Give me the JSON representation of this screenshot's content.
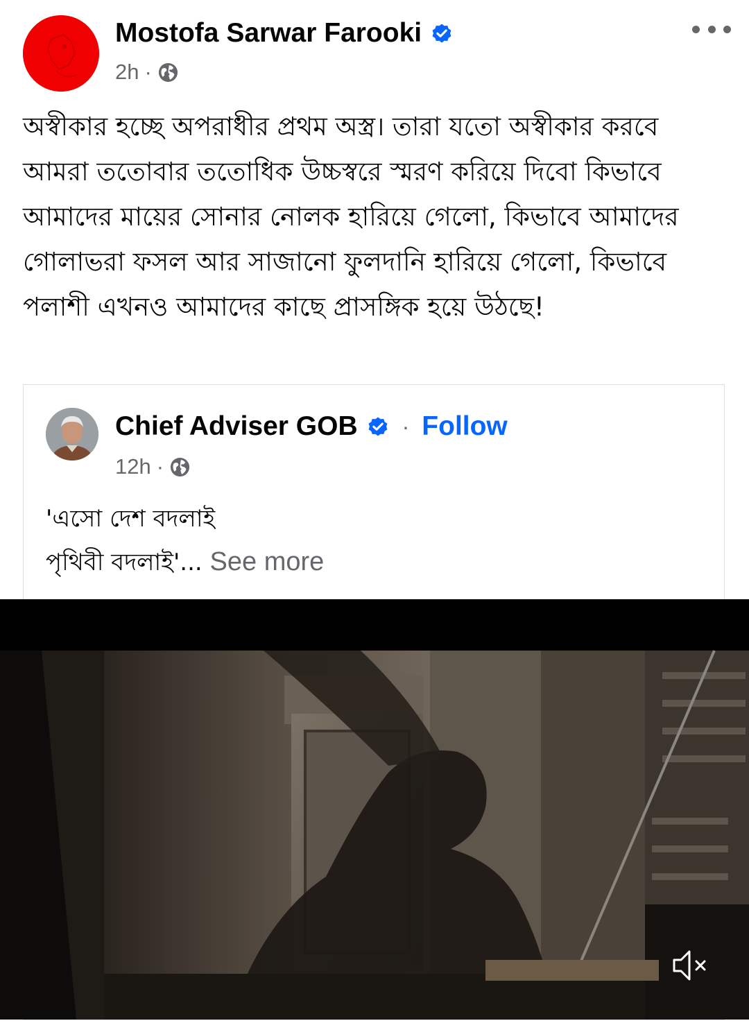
{
  "post": {
    "author": "Mostofa Sarwar Farooki",
    "time": "2h",
    "separator": "·",
    "privacy_icon": "globe-icon",
    "avatar_color": "#f00000",
    "text": "অস্বীকার হচ্ছে অপরাধীর প্রথম অস্ত্র। তারা যতো অস্বীকার করবে আমরা ততোবার ততোধিক উচ্চস্বরে স্মরণ করিয়ে দিবো কিভাবে আমাদের মায়ের সোনার নোলক হারিয়ে গেলো, কিভাবে আমাদের গোলাভরা ফসল আর সাজানো ফুলদানি হারিয়ে গেলো, কিভাবে পলাশী এখনও আমাদের কাছে প্রাসঙ্গিক হয়ে উঠছে!"
  },
  "shared_post": {
    "author": "Chief Adviser GOB",
    "separator": "·",
    "follow_label": "Follow",
    "time": "12h",
    "privacy_icon": "globe-icon",
    "text_line1": "'এসো দেশ বদলাই",
    "text_line2": "পৃথিবী বদলাই'...",
    "see_more": "See more"
  },
  "video": {
    "mute_icon": "speaker-muted-icon"
  },
  "colors": {
    "verified_blue": "#0866ff",
    "follow_blue": "#0866ff",
    "secondary_text": "#65676b"
  }
}
